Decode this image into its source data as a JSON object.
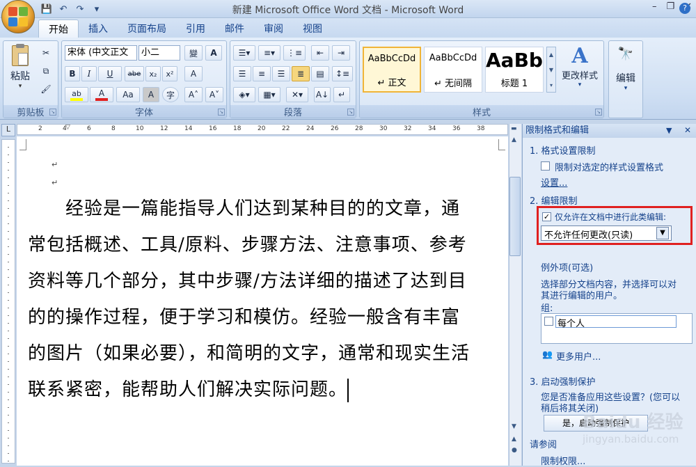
{
  "window": {
    "title": "新建 Microsoft Office Word 文档 - Microsoft Word",
    "min": "–",
    "max": "❐",
    "close": "✕"
  },
  "qat": {
    "save": "💾",
    "undo": "↶",
    "redo": "↷",
    "more": "▾"
  },
  "tabs": [
    "开始",
    "插入",
    "页面布局",
    "引用",
    "邮件",
    "审阅",
    "视图"
  ],
  "help": "?",
  "ribbon": {
    "clipboard": {
      "label": "剪贴板",
      "paste": "粘贴"
    },
    "font": {
      "label": "字体",
      "font_name": "宋体 (中文正文",
      "font_size": "小二",
      "wen": "變",
      "A_box": "A",
      "bold": "B",
      "italic": "I",
      "underline": "U",
      "strike": "abe",
      "sub": "x₂",
      "sup": "x²",
      "clear": "A",
      "aa": "Aa",
      "char_shade": "A",
      "enclose": "字",
      "grow": "A˄",
      "shrink": "A˅",
      "highlight": "ab",
      "font_color": "A"
    },
    "paragraph": {
      "label": "段落"
    },
    "styles": {
      "label": "样式",
      "cards": [
        {
          "sample": "AaBbCcDd",
          "name": "↵ 正文"
        },
        {
          "sample": "AaBbCcDd",
          "name": "↵ 无间隔"
        },
        {
          "sample": "AaBb",
          "name": "标题 1"
        }
      ],
      "change": "更改样式"
    },
    "editing": {
      "label": "编辑",
      "icon": "🔭"
    }
  },
  "ruler_numbers": [
    "2",
    "4",
    "6",
    "8",
    "10",
    "12",
    "14",
    "16",
    "18",
    "20",
    "22",
    "24",
    "26",
    "28",
    "30",
    "32",
    "34",
    "36",
    "38"
  ],
  "ruler_corner": "L",
  "document": {
    "empty_marks": [
      "↵",
      "↵"
    ],
    "lines": [
      "　　经验是一篇能指导人们达到某种目的的文章，通",
      "常包括概述、工具/原料、步骤方法、注意事项、参考",
      "资料等几个部分，其中步骤/方法详细的描述了达到目",
      "的的操作过程，便于学习和模仿。经验一般含有丰富",
      "的图片（如果必要），和简明的文字，通常和现实生活",
      "联系紧密，能帮助人们解决实际问题。"
    ]
  },
  "pane": {
    "title": "限制格式和编辑",
    "s1": "1. 格式设置限制",
    "s1_check": "限制对选定的样式设置格式",
    "s1_link": "设置...",
    "s2": "2. 编辑限制",
    "s2_check": "仅允许在文档中进行此类编辑:",
    "s2_select": "不允许任何更改(只读)",
    "exceptions": "例外项(可选)",
    "exc_desc1": "选择部分文档内容，并选择可以对",
    "exc_desc2": "其进行编辑的用户。",
    "group_label": "组:",
    "group_item": "每个人",
    "more_users": "更多用户...",
    "s3": "3. 启动强制保护",
    "s3_desc1": "您是否准备应用这些设置？(您可以",
    "s3_desc2": "稍后将其关闭)",
    "s3_button": "是，启动强制保护",
    "see_also": "请参阅",
    "perm_link": "限制权限...",
    "watermark": "Baidu 经验",
    "watermark_url": "jingyan.baidu.com"
  },
  "colors": {
    "highlight_box": "#e02020",
    "font_color_bar": "#e02020",
    "highlight_bar": "#ffff00"
  }
}
